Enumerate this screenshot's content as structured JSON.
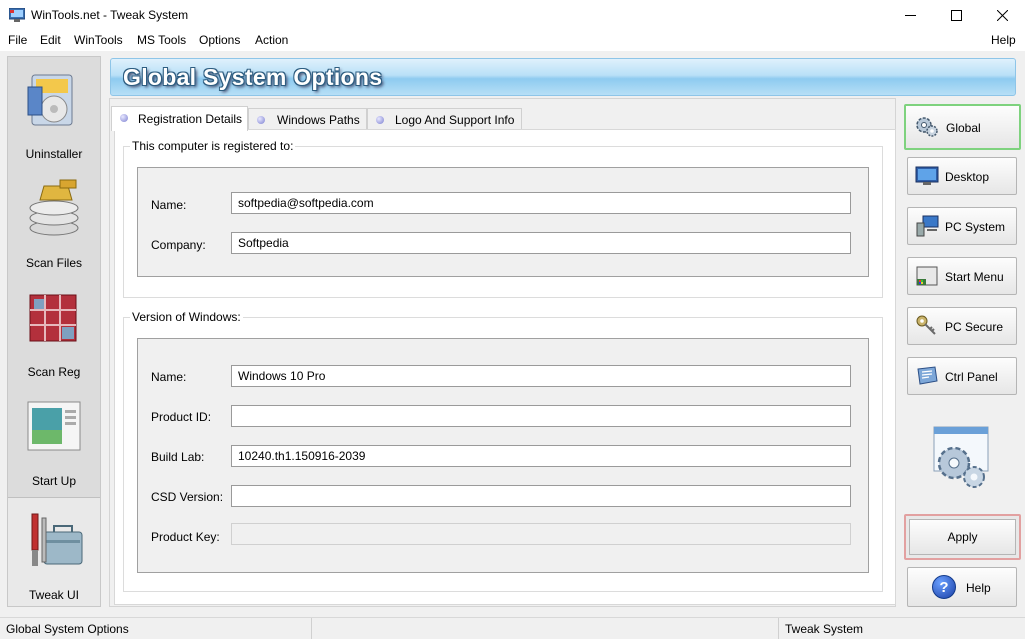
{
  "window": {
    "title": "WinTools.net - Tweak System"
  },
  "menu": [
    "File",
    "Edit",
    "WinTools",
    "MS Tools",
    "Options",
    "Action"
  ],
  "menu_help": "Help",
  "left_nav": [
    {
      "label": "Uninstaller",
      "icon": "uninstaller-icon"
    },
    {
      "label": "Scan Files",
      "icon": "scan-files-icon"
    },
    {
      "label": "Scan Reg",
      "icon": "scan-reg-icon"
    },
    {
      "label": "Start Up",
      "icon": "startup-icon"
    },
    {
      "label": "Tweak UI",
      "icon": "tweak-ui-icon",
      "active": true
    }
  ],
  "header": {
    "title": "Global System Options"
  },
  "tabs": [
    {
      "label": "Registration Details",
      "active": true
    },
    {
      "label": "Windows Paths"
    },
    {
      "label": "Logo And Support Info"
    }
  ],
  "registration": {
    "group_title": "This computer is registered to:",
    "name_label": "Name:",
    "name_value": "softpedia@softpedia.com",
    "company_label": "Company:",
    "company_value": "Softpedia"
  },
  "version": {
    "group_title": "Version of Windows:",
    "name_label": "Name:",
    "name_value": "Windows 10 Pro",
    "product_id_label": "Product ID:",
    "product_id_value": "",
    "build_lab_label": "Build Lab:",
    "build_lab_value": "10240.th1.150916-2039",
    "csd_label": "CSD Version:",
    "csd_value": "",
    "product_key_label": "Product Key:",
    "product_key_value": ""
  },
  "right_buttons": [
    {
      "label": "Global",
      "icon": "gears-icon",
      "selected": true
    },
    {
      "label": "Desktop",
      "icon": "monitor-icon"
    },
    {
      "label": "PC System",
      "icon": "pc-system-icon"
    },
    {
      "label": "Start Menu",
      "icon": "start-menu-icon"
    },
    {
      "label": "PC Secure",
      "icon": "keys-icon"
    },
    {
      "label": "Ctrl Panel",
      "icon": "control-panel-icon"
    }
  ],
  "apply_label": "Apply",
  "help_label": "Help",
  "status": {
    "left": "Global System Options",
    "right": "Tweak System"
  },
  "colors": {
    "header_gradient": "#8ecbf0",
    "selected_border": "#7ed27e",
    "apply_border": "#e2a0a0"
  }
}
